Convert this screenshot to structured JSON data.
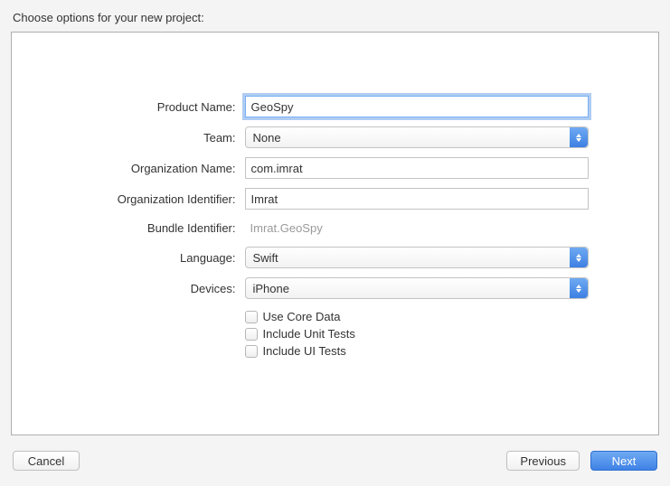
{
  "title": "Choose options for your new project:",
  "labels": {
    "productName": "Product Name:",
    "team": "Team:",
    "orgName": "Organization Name:",
    "orgIdent": "Organization Identifier:",
    "bundleIdent": "Bundle Identifier:",
    "language": "Language:",
    "devices": "Devices:"
  },
  "fields": {
    "productName": "GeoSpy",
    "team": "None",
    "orgName": "com.imrat",
    "orgIdent": "Imrat",
    "bundleIdent": "Imrat.GeoSpy",
    "language": "Swift",
    "devices": "iPhone"
  },
  "checkboxes": {
    "useCoreData": "Use Core Data",
    "includeUnitTests": "Include Unit Tests",
    "includeUITests": "Include UI Tests"
  },
  "buttons": {
    "cancel": "Cancel",
    "previous": "Previous",
    "next": "Next"
  }
}
